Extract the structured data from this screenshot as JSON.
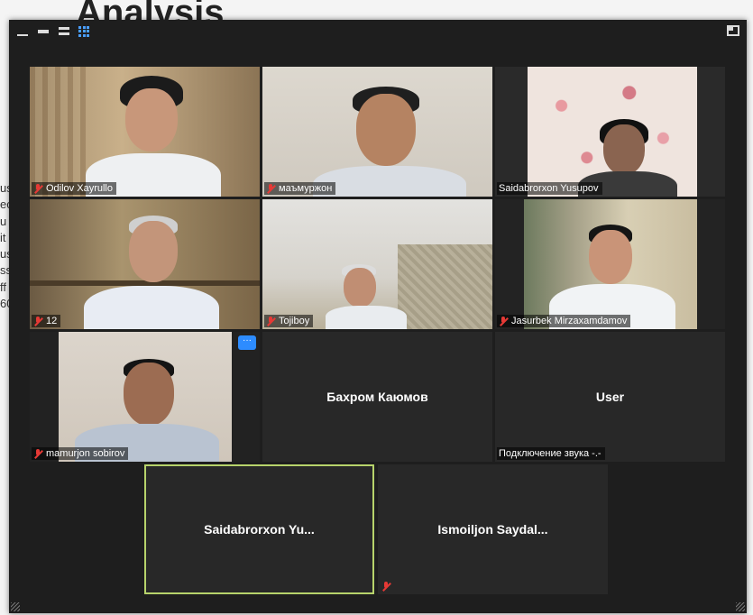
{
  "background": {
    "heading": "Analysis",
    "left_text_fragments": [
      "us",
      "ec",
      "u",
      "it",
      "us",
      "ss",
      "ff",
      "60"
    ]
  },
  "window": {
    "toolbar_icons": [
      "minimize-icon",
      "window-small-icon",
      "speaker-view-icon",
      "gallery-view-icon"
    ],
    "fullscreen_icon": "fullscreen-icon",
    "accent_color": "#2d8cff",
    "active_speaker_color": "#b7d36b",
    "mute_color": "#e53935"
  },
  "participants": [
    {
      "name": "Odilov Xayrullo",
      "muted": true,
      "video": true
    },
    {
      "name": "маъмуржон",
      "muted": true,
      "video": true
    },
    {
      "name": "Saidabrorxon Yusupov",
      "muted": false,
      "video": true
    },
    {
      "name": "12",
      "muted": true,
      "video": true
    },
    {
      "name": "Tojiboy",
      "muted": true,
      "video": true
    },
    {
      "name": "Jasurbek Mirzaxamdamov",
      "muted": true,
      "video": true
    },
    {
      "name": "mamurjon sobirov",
      "muted": true,
      "video": true,
      "more_label": "···"
    },
    {
      "name": "Бахром Каюмов",
      "muted": false,
      "video": false
    },
    {
      "name": "User",
      "muted": false,
      "video": false,
      "status": "Подключение звука -.-"
    },
    {
      "name": "Saidabrorxon  Yu...",
      "muted": false,
      "video": false,
      "active_speaker": true
    },
    {
      "name": "Ismoiljon  Saydal...",
      "muted": true,
      "video": false
    }
  ]
}
